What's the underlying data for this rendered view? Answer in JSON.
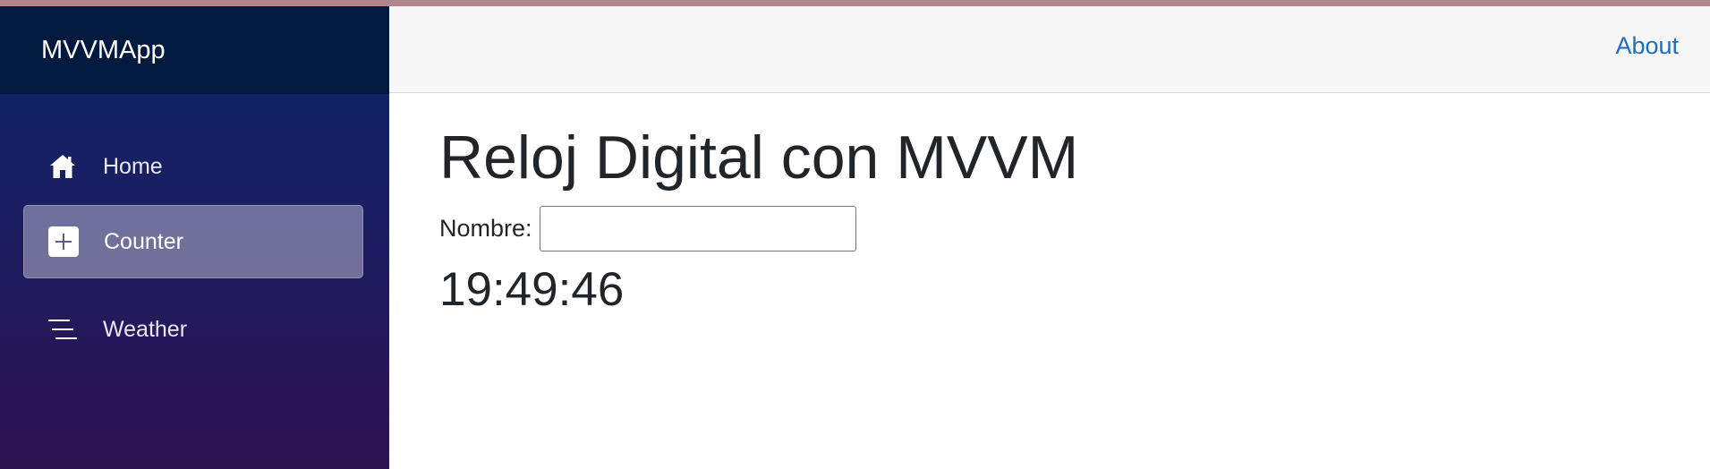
{
  "app": {
    "brand": "MVVMApp",
    "accent_color": "#b0868c"
  },
  "sidebar": {
    "items": [
      {
        "label": "Home",
        "icon": "home-icon",
        "active": false
      },
      {
        "label": "Counter",
        "icon": "plus-square-icon",
        "active": true
      },
      {
        "label": "Weather",
        "icon": "list-lines-icon",
        "active": false
      }
    ]
  },
  "topbar": {
    "about_label": "About",
    "link_color": "#1b6ec2"
  },
  "main": {
    "title": "Reloj Digital con MVVM",
    "name_label": "Nombre:",
    "name_value": "",
    "clock_time": "19:49:46"
  }
}
